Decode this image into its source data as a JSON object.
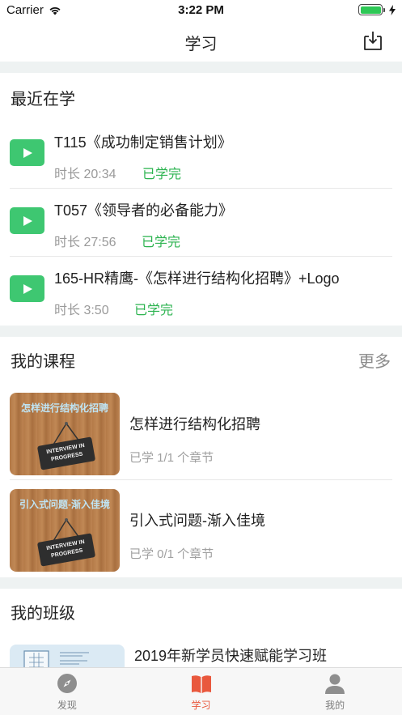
{
  "status_bar": {
    "carrier": "Carrier",
    "time": "3:22 PM",
    "battery_level": 1.0
  },
  "nav": {
    "title": "学习",
    "download_icon": "download-tray-icon"
  },
  "recent": {
    "title": "最近在学",
    "items": [
      {
        "title": "T115《成功制定销售计划》",
        "duration": "时长 20:34",
        "status": "已学完"
      },
      {
        "title": "T057《领导者的必备能力》",
        "duration": "时长 27:56",
        "status": "已学完"
      },
      {
        "title": "165-HR精鹰-《怎样进行结构化招聘》+Logo",
        "duration": "时长 3:50",
        "status": "已学完"
      }
    ]
  },
  "courses": {
    "title": "我的课程",
    "more": "更多",
    "items": [
      {
        "title": "怎样进行结构化招聘",
        "progress": "已学 1/1 个章节",
        "thumb_caption": "怎样进行结构化招聘",
        "thumb_sign": "INTERVIEW IN PROGRESS"
      },
      {
        "title": "引入式问题-渐入佳境",
        "progress": "已学 0/1 个章节",
        "thumb_caption": "引入式问题-渐入佳境",
        "thumb_sign": "INTERVIEW IN PROGRESS"
      }
    ]
  },
  "classes": {
    "title": "我的班级",
    "items": [
      {
        "title": "2019年新学员快速赋能学习班"
      }
    ]
  },
  "tab_bar": {
    "tabs": [
      {
        "label": "发现",
        "icon": "compass-icon",
        "active": false
      },
      {
        "label": "学习",
        "icon": "book-icon",
        "active": true
      },
      {
        "label": "我的",
        "icon": "person-icon",
        "active": false
      }
    ]
  },
  "colors": {
    "accent_green": "#3ec771",
    "status_green": "#2bb34f",
    "tab_active": "#e9583d",
    "section_gap": "#eef2f2"
  }
}
